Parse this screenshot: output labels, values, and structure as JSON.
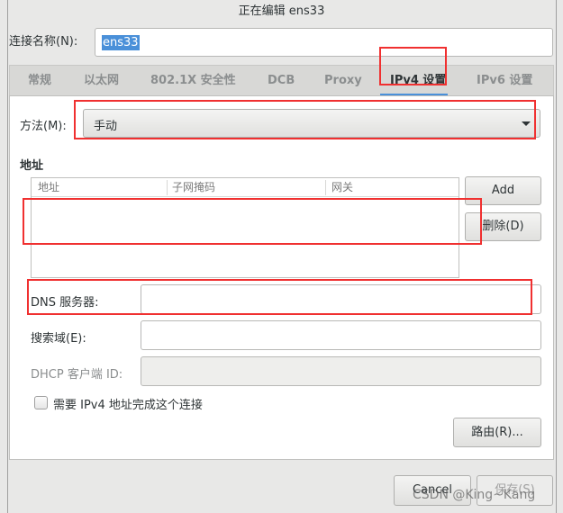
{
  "title": "正在编辑 ens33",
  "name_label": "连接名称(N):",
  "name_value": "ens33",
  "tabs": [
    "常规",
    "以太网",
    "802.1X 安全性",
    "DCB",
    "Proxy",
    "IPv4 设置",
    "IPv6 设置"
  ],
  "active_tab": "IPv4 设置",
  "method_label": "方法(M):",
  "method_value": "手动",
  "address_section": "地址",
  "address_columns": [
    "地址",
    "子网掩码",
    "网关"
  ],
  "add_button": "Add",
  "delete_button": "删除(D)",
  "dns_label": "DNS 服务器:",
  "dns_value": "",
  "search_label": "搜索域(E):",
  "search_value": "",
  "dhcp_label": "DHCP 客户端 ID:",
  "dhcp_value": "",
  "require_ipv4_label": "需要 IPv4 地址完成这个连接",
  "require_ipv4_checked": false,
  "routes_button": "路由(R)...",
  "cancel_button": "Cancel",
  "save_button": "保存(S)",
  "watermark": "CSDN @King~Kang",
  "colors": {
    "selection": "#4a90d9",
    "active_tab_underline": "#4a90d9",
    "annotation": "#f03030"
  }
}
